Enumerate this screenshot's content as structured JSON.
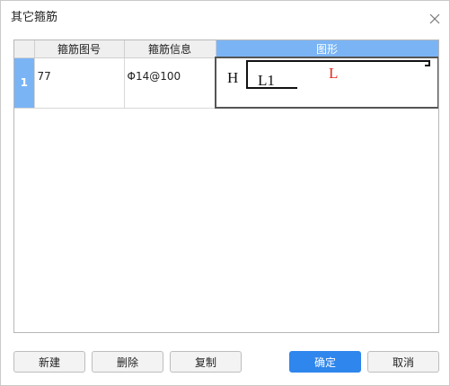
{
  "dialog": {
    "title": "其它箍筋",
    "close_icon": "close-icon"
  },
  "table": {
    "columns": [
      "",
      "箍筋图号",
      "箍筋信息",
      "图形"
    ],
    "selected_column": 3,
    "rows": [
      {
        "index": "1",
        "figure_no": "77",
        "info": "Φ14@100",
        "shape": {
          "labels": {
            "h": "H",
            "l1": "L1",
            "l": "L"
          },
          "label_colors": {
            "h": "#111111",
            "l1": "#111111",
            "l": "#e8281e"
          }
        }
      }
    ]
  },
  "buttons": {
    "new": "新建",
    "delete": "删除",
    "copy": "复制",
    "ok": "确定",
    "cancel": "取消"
  },
  "colors": {
    "accent": "#2f86ec",
    "selection": "#7ab4f5"
  }
}
